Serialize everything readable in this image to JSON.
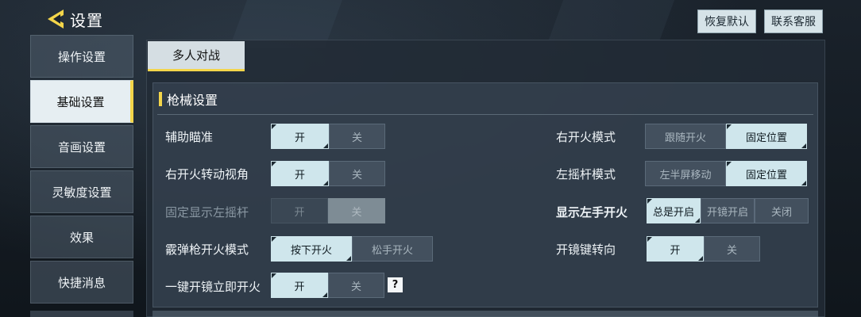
{
  "header": {
    "title": "设置",
    "restore_default": "恢复默认",
    "contact_service": "联系客服"
  },
  "colors": {
    "accent": "#f3d54a",
    "active_option": "#cfe6ec"
  },
  "nav": {
    "items": [
      {
        "label": "操作设置"
      },
      {
        "label": "基础设置",
        "active": true
      },
      {
        "label": "音画设置"
      },
      {
        "label": "灵敏度设置"
      },
      {
        "label": "效果"
      },
      {
        "label": "快捷消息"
      }
    ]
  },
  "mode_tab": {
    "label": "多人对战"
  },
  "section": {
    "title": "枪械设置"
  },
  "left_settings": [
    {
      "label": "辅助瞄准",
      "options": [
        "开",
        "关"
      ],
      "selected": 0
    },
    {
      "label": "右开火转动视角",
      "options": [
        "开",
        "关"
      ],
      "selected": 0
    },
    {
      "label": "固定显示左摇杆",
      "options": [
        "开",
        "关"
      ],
      "selected": 1,
      "disabled": true
    },
    {
      "label": "霰弹枪开火模式",
      "options": [
        "按下开火",
        "松手开火"
      ],
      "selected": 0
    },
    {
      "label": "一键开镜立即开火",
      "options": [
        "开",
        "关"
      ],
      "selected": 0
    }
  ],
  "right_settings": [
    {
      "label": "右开火模式",
      "options": [
        "跟随开火",
        "固定位置"
      ],
      "selected": 1
    },
    {
      "label": "左摇杆模式",
      "options": [
        "左半屏移动",
        "固定位置"
      ],
      "selected": 1
    },
    {
      "label": "显示左手开火",
      "options": [
        "总是开启",
        "开镜开启",
        "关闭"
      ],
      "selected": 0
    },
    {
      "label": "开镜键转向",
      "options": [
        "开",
        "关"
      ],
      "selected": 0
    }
  ],
  "help_icon": "?"
}
